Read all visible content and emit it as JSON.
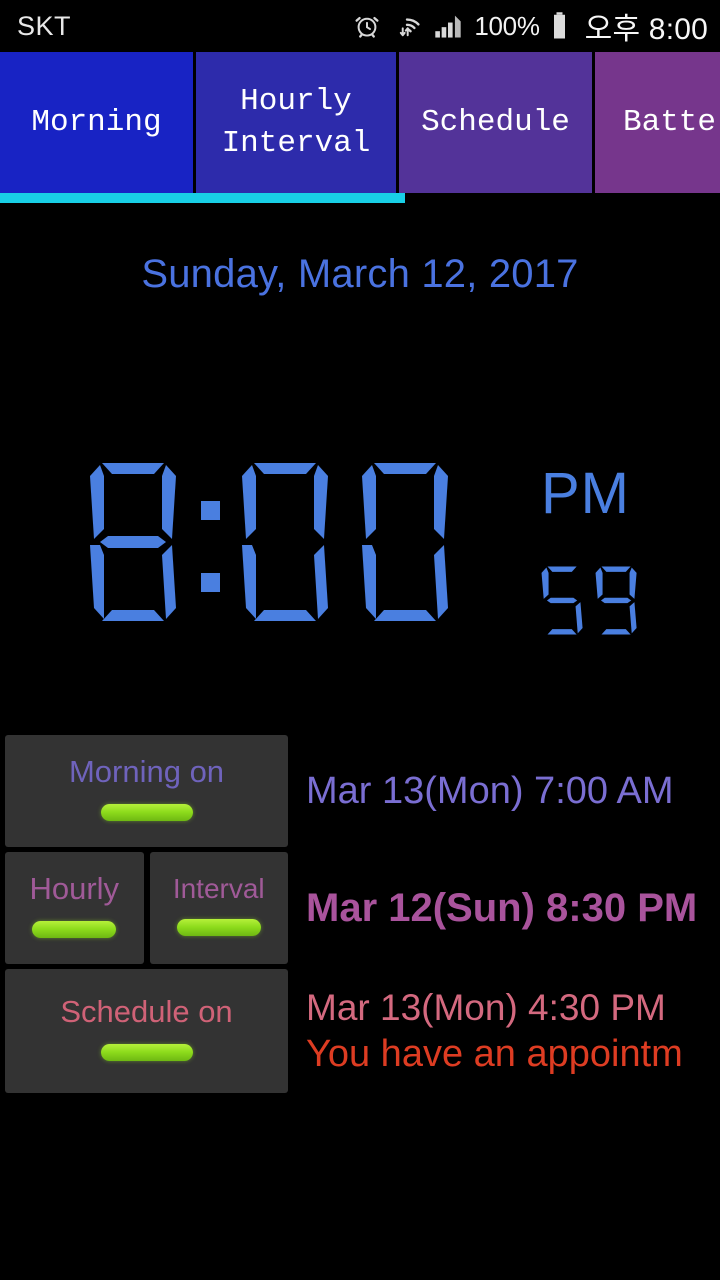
{
  "statusbar": {
    "carrier": "SKT",
    "battery_percent": "100%",
    "time": "오후 8:00",
    "icons": [
      "alarm-icon",
      "wifi-icon",
      "signal-icon",
      "battery-icon"
    ]
  },
  "tabs": [
    {
      "label": "Morning",
      "color": "#1823c4",
      "selected": true
    },
    {
      "label": "Hourly\nInterval",
      "color": "#2d2bab",
      "selected": false
    },
    {
      "label": "Schedule",
      "color": "#533399",
      "selected": false
    },
    {
      "label": "Batte",
      "color": "#76368c",
      "selected": false
    }
  ],
  "indicator_color": "#18cfe6",
  "main": {
    "date": "Sunday, March 12, 2017",
    "time_digits": "8:00",
    "ampm": "PM",
    "seconds": "59",
    "clock_color": "#4a7fe0"
  },
  "alarms": [
    {
      "buttons": [
        {
          "label": "Morning on",
          "toggle": "on"
        }
      ],
      "lines": [
        "Mar 13(Mon) 7:00 AM"
      ],
      "text_color": "#7a6ed2"
    },
    {
      "buttons": [
        {
          "label": "Hourly",
          "toggle": "on"
        },
        {
          "label": "Interval",
          "toggle": "on"
        }
      ],
      "lines": [
        "Mar 12(Sun) 8:30 PM"
      ],
      "text_color": "#a9539c"
    },
    {
      "buttons": [
        {
          "label": "Schedule on",
          "toggle": "on"
        }
      ],
      "lines": [
        "Mar 13(Mon) 4:30 PM",
        "You have an appointm"
      ],
      "text_color": "#d4697f",
      "message_color": "#dd3c22"
    }
  ]
}
